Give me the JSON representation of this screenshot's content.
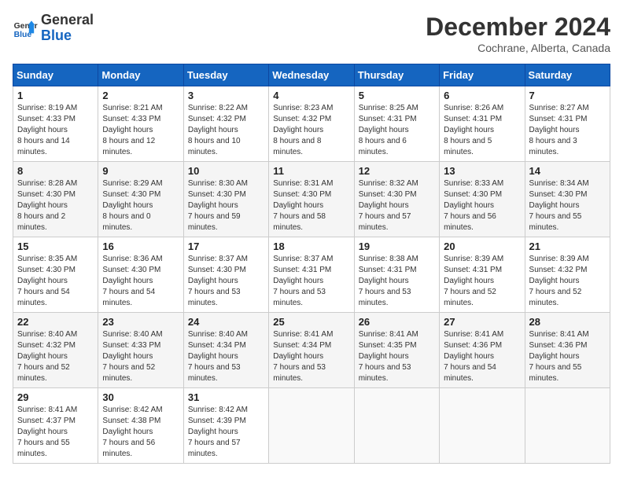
{
  "logo": {
    "line1": "General",
    "line2": "Blue"
  },
  "title": "December 2024",
  "location": "Cochrane, Alberta, Canada",
  "days_of_week": [
    "Sunday",
    "Monday",
    "Tuesday",
    "Wednesday",
    "Thursday",
    "Friday",
    "Saturday"
  ],
  "weeks": [
    [
      {
        "day": "1",
        "sunrise": "8:19 AM",
        "sunset": "4:33 PM",
        "daylight": "8 hours and 14 minutes."
      },
      {
        "day": "2",
        "sunrise": "8:21 AM",
        "sunset": "4:33 PM",
        "daylight": "8 hours and 12 minutes."
      },
      {
        "day": "3",
        "sunrise": "8:22 AM",
        "sunset": "4:32 PM",
        "daylight": "8 hours and 10 minutes."
      },
      {
        "day": "4",
        "sunrise": "8:23 AM",
        "sunset": "4:32 PM",
        "daylight": "8 hours and 8 minutes."
      },
      {
        "day": "5",
        "sunrise": "8:25 AM",
        "sunset": "4:31 PM",
        "daylight": "8 hours and 6 minutes."
      },
      {
        "day": "6",
        "sunrise": "8:26 AM",
        "sunset": "4:31 PM",
        "daylight": "8 hours and 5 minutes."
      },
      {
        "day": "7",
        "sunrise": "8:27 AM",
        "sunset": "4:31 PM",
        "daylight": "8 hours and 3 minutes."
      }
    ],
    [
      {
        "day": "8",
        "sunrise": "8:28 AM",
        "sunset": "4:30 PM",
        "daylight": "8 hours and 2 minutes."
      },
      {
        "day": "9",
        "sunrise": "8:29 AM",
        "sunset": "4:30 PM",
        "daylight": "8 hours and 0 minutes."
      },
      {
        "day": "10",
        "sunrise": "8:30 AM",
        "sunset": "4:30 PM",
        "daylight": "7 hours and 59 minutes."
      },
      {
        "day": "11",
        "sunrise": "8:31 AM",
        "sunset": "4:30 PM",
        "daylight": "7 hours and 58 minutes."
      },
      {
        "day": "12",
        "sunrise": "8:32 AM",
        "sunset": "4:30 PM",
        "daylight": "7 hours and 57 minutes."
      },
      {
        "day": "13",
        "sunrise": "8:33 AM",
        "sunset": "4:30 PM",
        "daylight": "7 hours and 56 minutes."
      },
      {
        "day": "14",
        "sunrise": "8:34 AM",
        "sunset": "4:30 PM",
        "daylight": "7 hours and 55 minutes."
      }
    ],
    [
      {
        "day": "15",
        "sunrise": "8:35 AM",
        "sunset": "4:30 PM",
        "daylight": "7 hours and 54 minutes."
      },
      {
        "day": "16",
        "sunrise": "8:36 AM",
        "sunset": "4:30 PM",
        "daylight": "7 hours and 54 minutes."
      },
      {
        "day": "17",
        "sunrise": "8:37 AM",
        "sunset": "4:30 PM",
        "daylight": "7 hours and 53 minutes."
      },
      {
        "day": "18",
        "sunrise": "8:37 AM",
        "sunset": "4:31 PM",
        "daylight": "7 hours and 53 minutes."
      },
      {
        "day": "19",
        "sunrise": "8:38 AM",
        "sunset": "4:31 PM",
        "daylight": "7 hours and 53 minutes."
      },
      {
        "day": "20",
        "sunrise": "8:39 AM",
        "sunset": "4:31 PM",
        "daylight": "7 hours and 52 minutes."
      },
      {
        "day": "21",
        "sunrise": "8:39 AM",
        "sunset": "4:32 PM",
        "daylight": "7 hours and 52 minutes."
      }
    ],
    [
      {
        "day": "22",
        "sunrise": "8:40 AM",
        "sunset": "4:32 PM",
        "daylight": "7 hours and 52 minutes."
      },
      {
        "day": "23",
        "sunrise": "8:40 AM",
        "sunset": "4:33 PM",
        "daylight": "7 hours and 52 minutes."
      },
      {
        "day": "24",
        "sunrise": "8:40 AM",
        "sunset": "4:34 PM",
        "daylight": "7 hours and 53 minutes."
      },
      {
        "day": "25",
        "sunrise": "8:41 AM",
        "sunset": "4:34 PM",
        "daylight": "7 hours and 53 minutes."
      },
      {
        "day": "26",
        "sunrise": "8:41 AM",
        "sunset": "4:35 PM",
        "daylight": "7 hours and 53 minutes."
      },
      {
        "day": "27",
        "sunrise": "8:41 AM",
        "sunset": "4:36 PM",
        "daylight": "7 hours and 54 minutes."
      },
      {
        "day": "28",
        "sunrise": "8:41 AM",
        "sunset": "4:36 PM",
        "daylight": "7 hours and 55 minutes."
      }
    ],
    [
      {
        "day": "29",
        "sunrise": "8:41 AM",
        "sunset": "4:37 PM",
        "daylight": "7 hours and 55 minutes."
      },
      {
        "day": "30",
        "sunrise": "8:42 AM",
        "sunset": "4:38 PM",
        "daylight": "7 hours and 56 minutes."
      },
      {
        "day": "31",
        "sunrise": "8:42 AM",
        "sunset": "4:39 PM",
        "daylight": "7 hours and 57 minutes."
      },
      null,
      null,
      null,
      null
    ]
  ]
}
